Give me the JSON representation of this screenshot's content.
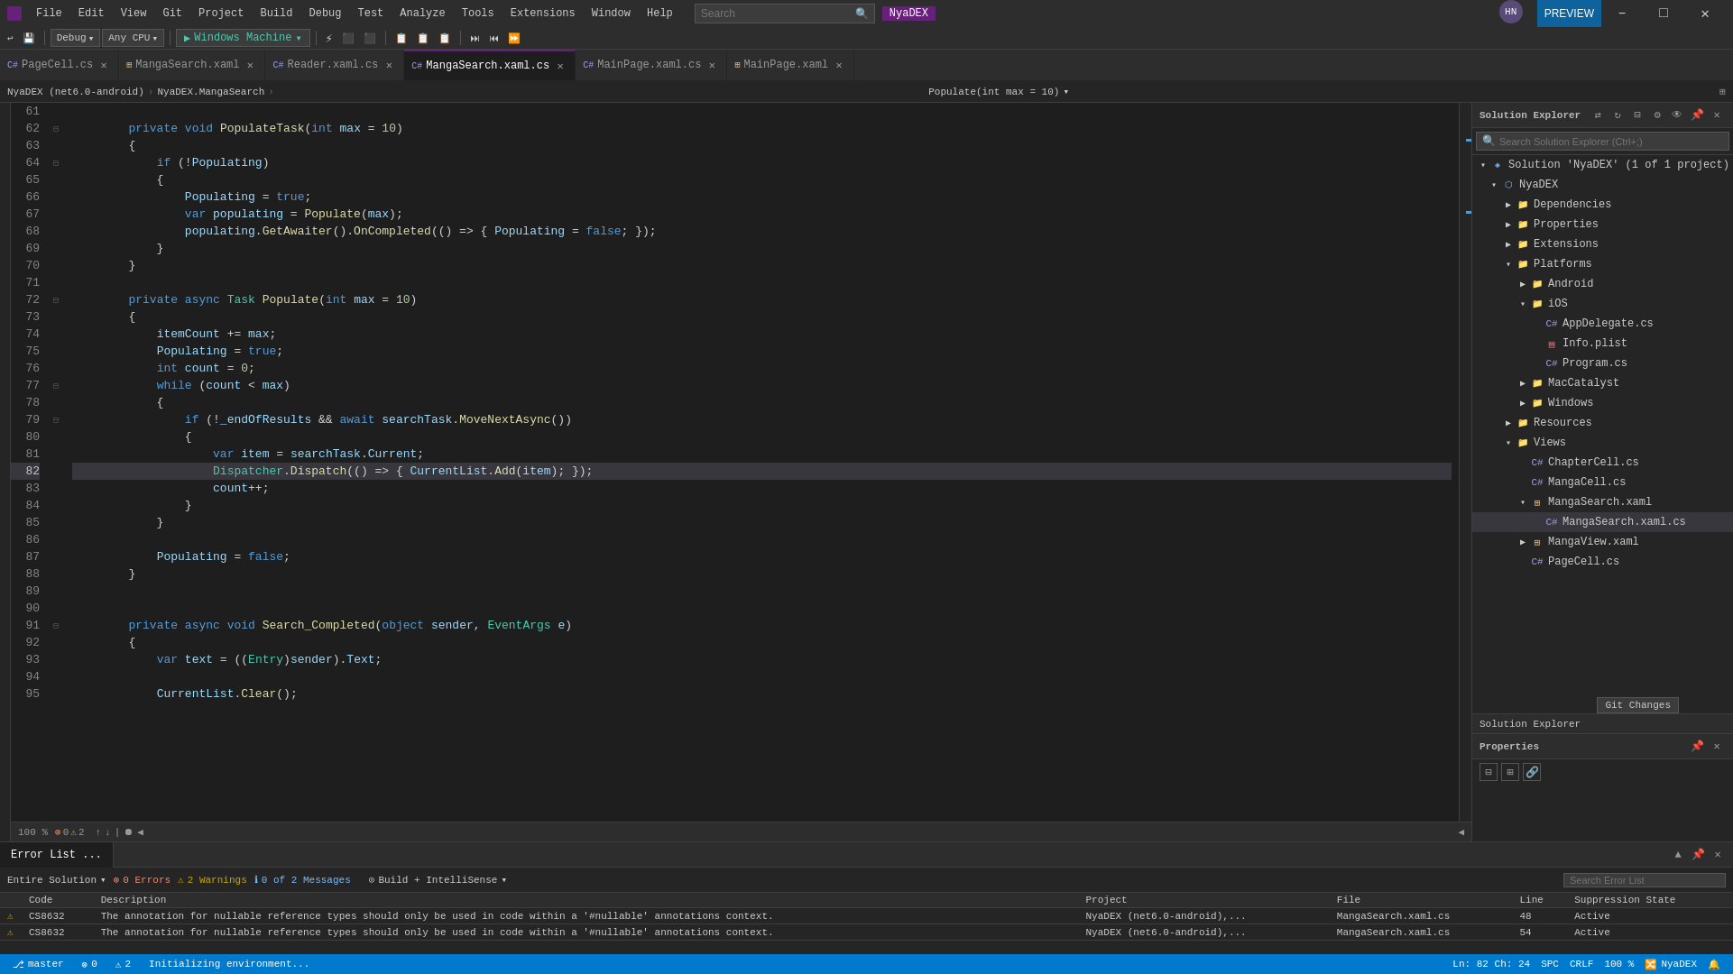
{
  "titlebar": {
    "logo_text": "VS",
    "menu": [
      "File",
      "Edit",
      "View",
      "Git",
      "Project",
      "Build",
      "Debug",
      "Test",
      "Analyze",
      "Tools",
      "Extensions",
      "Window",
      "Help"
    ],
    "search_placeholder": "Search",
    "app_name": "NyaDEX",
    "user_initials": "HN",
    "preview_label": "PREVIEW"
  },
  "toolbar": {
    "mode": "Debug",
    "platform": "Any CPU",
    "run_label": "Windows Machine",
    "back_label": "←",
    "forward_label": "→"
  },
  "tabs": [
    {
      "label": "PageCell.cs",
      "active": false,
      "modified": false
    },
    {
      "label": "MangaSearch.xaml",
      "active": false,
      "modified": false
    },
    {
      "label": "Reader.xaml.cs",
      "active": false,
      "modified": false
    },
    {
      "label": "MangaSearch.xaml.cs",
      "active": true,
      "modified": false
    },
    {
      "label": "MainPage.xaml.cs",
      "active": false,
      "modified": false
    },
    {
      "label": "MainPage.xaml",
      "active": false,
      "modified": false
    }
  ],
  "editor": {
    "file_path": "NyaDEX (net6.0-android)",
    "namespace": "NyaDEX.MangaSearch",
    "member": "Populate(int max = 10)",
    "lines": [
      {
        "num": 61,
        "text": ""
      },
      {
        "num": 62,
        "text": "\t\tprivate void PopulateTask(int max = 10)"
      },
      {
        "num": 63,
        "text": "\t\t{"
      },
      {
        "num": 64,
        "text": "\t\t\tif (!Populating)"
      },
      {
        "num": 65,
        "text": "\t\t\t{"
      },
      {
        "num": 66,
        "text": "\t\t\t\tPopulating = true;"
      },
      {
        "num": 67,
        "text": "\t\t\t\tvar populating = Populate(max);"
      },
      {
        "num": 68,
        "text": "\t\t\t\tpopulating.GetAwaiter().OnCompleted(() => { Populating = false; });"
      },
      {
        "num": 69,
        "text": "\t\t\t}"
      },
      {
        "num": 70,
        "text": "\t\t}"
      },
      {
        "num": 71,
        "text": ""
      },
      {
        "num": 72,
        "text": "\t\tprivate async Task Populate(int max = 10)"
      },
      {
        "num": 73,
        "text": "\t\t{"
      },
      {
        "num": 74,
        "text": "\t\t\titemCount += max;"
      },
      {
        "num": 75,
        "text": "\t\t\tPopulating = true;"
      },
      {
        "num": 76,
        "text": "\t\t\tint count = 0;"
      },
      {
        "num": 77,
        "text": "\t\t\twhile (count < max)"
      },
      {
        "num": 78,
        "text": "\t\t\t{"
      },
      {
        "num": 79,
        "text": "\t\t\t\tif (!_endOfResults && await searchTask.MoveNextAsync())"
      },
      {
        "num": 80,
        "text": "\t\t\t\t{"
      },
      {
        "num": 81,
        "text": "\t\t\t\t\tvar item = searchTask.Current;"
      },
      {
        "num": 82,
        "text": "\t\t\t\t\tDispatcher.Dispatch(() => { CurrentList.Add(item); });"
      },
      {
        "num": 83,
        "text": "\t\t\t\t\tcount++;"
      },
      {
        "num": 84,
        "text": "\t\t\t\t}"
      },
      {
        "num": 85,
        "text": "\t\t\t}"
      },
      {
        "num": 86,
        "text": ""
      },
      {
        "num": 87,
        "text": "\t\t\tPopulating = false;"
      },
      {
        "num": 88,
        "text": "\t\t}"
      },
      {
        "num": 89,
        "text": ""
      },
      {
        "num": 90,
        "text": ""
      },
      {
        "num": 91,
        "text": "\t\tprivate async void Search_Completed(object sender, EventArgs e)"
      },
      {
        "num": 92,
        "text": "\t\t{"
      },
      {
        "num": 93,
        "text": "\t\t\tvar text = ((Entry)sender).Text;"
      },
      {
        "num": 94,
        "text": ""
      },
      {
        "num": 95,
        "text": "\t\t\tCurrentList.Clear();"
      }
    ],
    "zoom": "100 %",
    "errors": 0,
    "warnings": 2,
    "cursor": "Ln: 82  Ch: 24",
    "encoding": "SPC",
    "line_ending": "CRLF"
  },
  "solution_explorer": {
    "title": "Solution Explorer",
    "search_placeholder": "Search Solution Explorer (Ctrl+;)",
    "tree": [
      {
        "label": "Solution 'NyaDEX' (1 of 1 project)",
        "level": 0,
        "type": "solution",
        "expanded": true
      },
      {
        "label": "NyaDEX",
        "level": 1,
        "type": "project",
        "expanded": true
      },
      {
        "label": "Dependencies",
        "level": 2,
        "type": "folder",
        "expanded": false
      },
      {
        "label": "Properties",
        "level": 2,
        "type": "folder",
        "expanded": false
      },
      {
        "label": "Extensions",
        "level": 2,
        "type": "folder",
        "expanded": false
      },
      {
        "label": "Platforms",
        "level": 2,
        "type": "folder",
        "expanded": true
      },
      {
        "label": "Android",
        "level": 3,
        "type": "folder",
        "expanded": false
      },
      {
        "label": "iOS",
        "level": 3,
        "type": "folder",
        "expanded": true
      },
      {
        "label": "AppDelegate.cs",
        "level": 4,
        "type": "cs",
        "expanded": false
      },
      {
        "label": "Info.plist",
        "level": 4,
        "type": "plist",
        "expanded": false
      },
      {
        "label": "Program.cs",
        "level": 4,
        "type": "cs",
        "expanded": false
      },
      {
        "label": "MacCatalyst",
        "level": 3,
        "type": "folder",
        "expanded": false
      },
      {
        "label": "Windows",
        "level": 3,
        "type": "folder",
        "expanded": false
      },
      {
        "label": "Resources",
        "level": 2,
        "type": "folder",
        "expanded": false
      },
      {
        "label": "Views",
        "level": 2,
        "type": "folder",
        "expanded": true
      },
      {
        "label": "ChapterCell.cs",
        "level": 3,
        "type": "cs",
        "expanded": false
      },
      {
        "label": "MangaCell.cs",
        "level": 3,
        "type": "cs",
        "expanded": false
      },
      {
        "label": "MangaSearch.xaml",
        "level": 3,
        "type": "xaml",
        "expanded": true
      },
      {
        "label": "MangaSearch.xaml.cs",
        "level": 4,
        "type": "cs",
        "expanded": false,
        "selected": true
      },
      {
        "label": "MangaView.xaml",
        "level": 3,
        "type": "xaml",
        "expanded": false
      },
      {
        "label": "PageCell.cs",
        "level": 3,
        "type": "cs",
        "expanded": false
      }
    ],
    "tooltip": "Git Changes"
  },
  "properties": {
    "title": "Properties"
  },
  "error_list": {
    "title": "Error List ...",
    "scope_label": "Entire Solution",
    "errors_count": "0 Errors",
    "warnings_count": "2 Warnings",
    "messages_count": "0 of 2 Messages",
    "build_label": "Build + IntelliSense",
    "search_placeholder": "Search Error List",
    "columns": [
      "",
      "Code",
      "Description",
      "Project",
      "File",
      "Line",
      "Suppression State"
    ],
    "rows": [
      {
        "severity": "warning",
        "code": "CS8632",
        "description": "The annotation for nullable reference types should only be used in code within a '#nullable' annotations context.",
        "project": "NyaDEX (net6.0-android),...",
        "file": "MangaSearch.xaml.cs",
        "line": "48",
        "suppression": "Active"
      },
      {
        "severity": "warning",
        "code": "CS8632",
        "description": "The annotation for nullable reference types should only be used in code within a '#nullable' annotations context.",
        "project": "NyaDEX (net6.0-android),...",
        "file": "MangaSearch.xaml.cs",
        "line": "54",
        "suppression": "Active"
      }
    ]
  },
  "statusbar": {
    "branch": "master",
    "errors": "0",
    "warnings": "2",
    "cursor_info": "Ln: 82  Ch: 24",
    "encoding": "SPC",
    "line_ending": "CRLF",
    "zoom": "100 %",
    "status_text": "Initializing environment...",
    "nyadex": "NyaDEX",
    "git_icon": "⎇"
  }
}
